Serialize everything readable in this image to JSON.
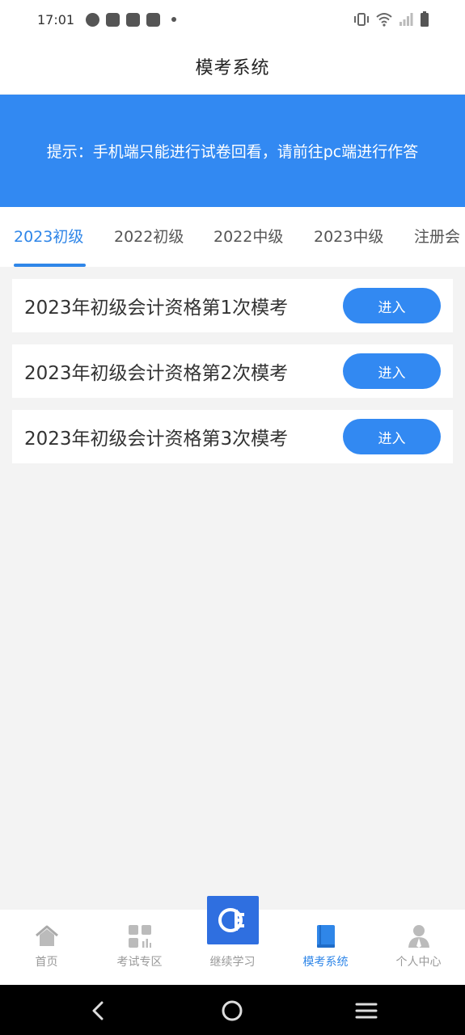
{
  "status_bar": {
    "time": "17:01",
    "left_icons": [
      "ringer-icon",
      "bag-icon",
      "bag-icon",
      "bag-icon",
      "dot-icon"
    ],
    "right_icons": [
      "vibrate-icon",
      "wifi-icon",
      "signal-icon",
      "battery-icon"
    ]
  },
  "header": {
    "title": "模考系统"
  },
  "notice": {
    "text": "提示：手机端只能进行试卷回看，请前往pc端进行作答"
  },
  "tabs": [
    {
      "label": "2023初级",
      "active": true
    },
    {
      "label": "2022初级",
      "active": false
    },
    {
      "label": "2022中级",
      "active": false
    },
    {
      "label": "2023中级",
      "active": false
    },
    {
      "label": "注册会",
      "active": false
    }
  ],
  "exams": [
    {
      "title": "2023年初级会计资格第1次模考",
      "button": "进入"
    },
    {
      "title": "2023年初级会计资格第2次模考",
      "button": "进入"
    },
    {
      "title": "2023年初级会计资格第3次模考",
      "button": "进入"
    }
  ],
  "bottom_nav": [
    {
      "label": "首页",
      "icon": "home-icon",
      "active": false
    },
    {
      "label": "考试专区",
      "icon": "grid-icon",
      "active": false
    },
    {
      "label": "继续学习",
      "icon": "app-logo-icon",
      "active": false
    },
    {
      "label": "模考系统",
      "icon": "book-icon",
      "active": true
    },
    {
      "label": "个人中心",
      "icon": "user-icon",
      "active": false
    }
  ],
  "system_nav": [
    "back-icon",
    "home-circle-icon",
    "menu-icon"
  ],
  "colors": {
    "accent": "#3289f2",
    "active_tab": "#2f86e8",
    "background": "#f3f3f3"
  }
}
